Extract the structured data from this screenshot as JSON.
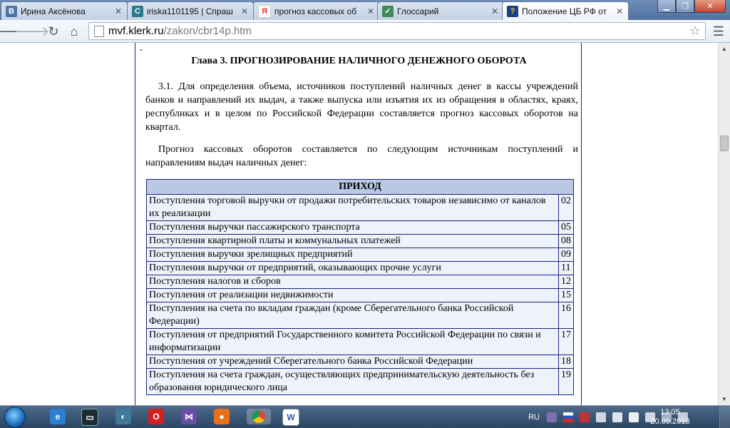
{
  "browser": {
    "tabs": [
      {
        "title": "Ирина Аксёнова",
        "favicon": "vk-icon",
        "favicon_text": "В",
        "favicon_color": "#4a76a8",
        "active": false
      },
      {
        "title": "iriska1101195 | Спраш",
        "favicon": "sprashivai-icon",
        "favicon_text": "C",
        "favicon_color": "#2a7a8c",
        "active": false
      },
      {
        "title": "прогноз кассовых об",
        "favicon": "yandex-icon",
        "favicon_text": "Я",
        "favicon_color": "#e8312a",
        "active": false
      },
      {
        "title": "Глоссарий",
        "favicon": "glossary-icon",
        "favicon_text": "✓",
        "favicon_color": "#3e8a5b",
        "active": false
      },
      {
        "title": "Положение ЦБ РФ от",
        "favicon": "help-icon",
        "favicon_text": "?",
        "favicon_color": "#1c3f8c",
        "active": true
      }
    ],
    "url_host": "mvf.klerk.ru",
    "url_path": "/zakon/cbr14p.htm"
  },
  "document": {
    "dash": "-",
    "chapter_title": "Глава 3. ПРОГНОЗИРОВАНИЕ НАЛИЧНОГО ДЕНЕЖНОГО ОБОРОТА",
    "paragraph_1": "3.1. Для определения объема, источников поступлений наличных денег в кассы учреждений банков и направлений их выдач, а также выпуска или изъятия их из обращения в областях, краях, республиках и в целом по Российской Федерации составляется прогноз кассовых оборотов на квартал.",
    "paragraph_2": "Прогноз кассовых оборотов составляется по следующим источникам поступлений и направлениям выдач наличных денег:",
    "table": {
      "header": "ПРИХОД",
      "rows": [
        {
          "label": "Поступления торговой выручки от продажи потребительских товаров независимо от каналов их реализации",
          "code": "02"
        },
        {
          "label": "Поступления выручки пассажирского транспорта",
          "code": "05"
        },
        {
          "label": "Поступления квартирной платы и коммунальных платежей",
          "code": "08"
        },
        {
          "label": "Поступления выручки зрелищных предприятий",
          "code": "09"
        },
        {
          "label": "Поступления выручки от предприятий, оказывающих прочие услуги",
          "code": "11"
        },
        {
          "label": "Поступления налогов и сборов",
          "code": "12"
        },
        {
          "label": "Поступления от реализации недвижимости",
          "code": "15"
        },
        {
          "label": "Поступления на счета по вкладам граждан (кроме Сберегательного банка Российской Федерации)",
          "code": "16"
        },
        {
          "label": "Поступления от предприятий Государственного комитета Российской Федерации по связи и информатизации",
          "code": "17"
        },
        {
          "label": "Поступления от учреждений Сберегательного банка Российской Федерации",
          "code": "18"
        },
        {
          "label": "Поступления на счета граждан, осуществляющих предпринимательскую деятельность без образования юридического лица",
          "code": "19"
        }
      ]
    }
  },
  "taskbar": {
    "language": "RU",
    "time": "13:05",
    "date": "20.05.2013"
  }
}
